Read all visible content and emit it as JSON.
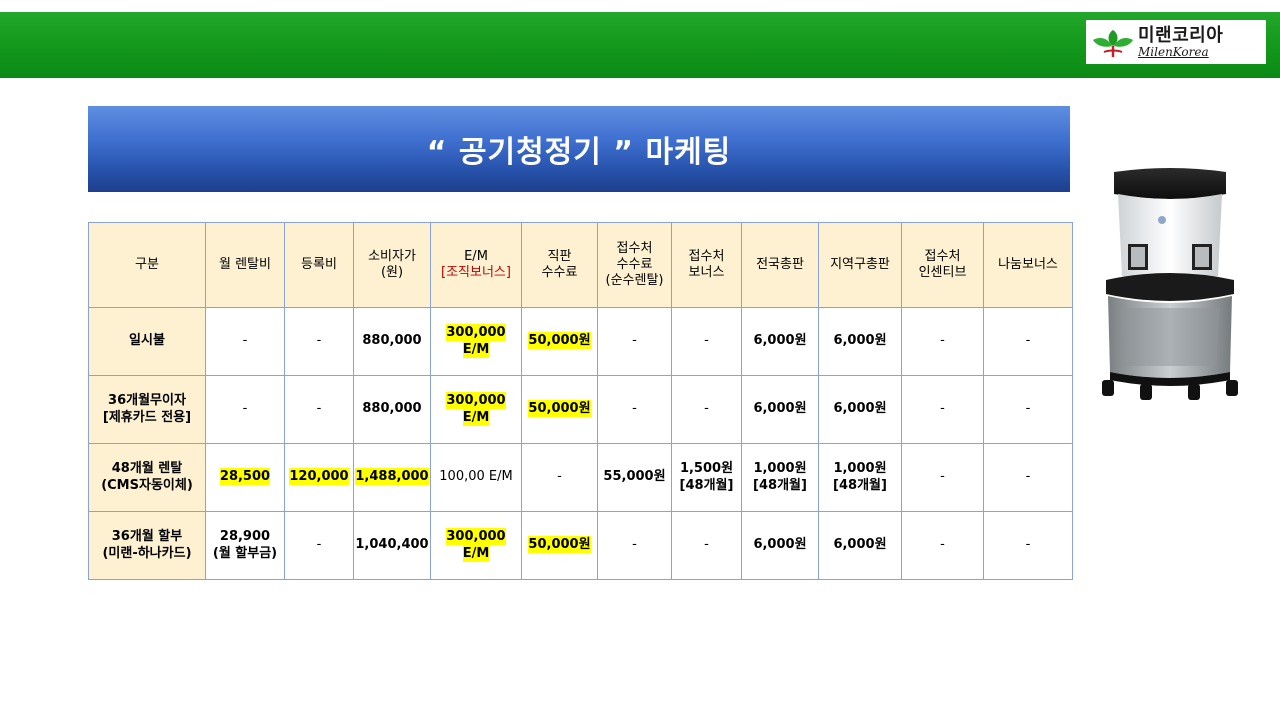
{
  "logo": {
    "korean": "미랜코리아",
    "english": "MilenKorea"
  },
  "title": "“ 공기청정기 ” 마케팅",
  "table": {
    "headers": [
      {
        "lines": [
          "구분"
        ]
      },
      {
        "lines": [
          "월 렌탈비"
        ]
      },
      {
        "lines": [
          "등록비"
        ]
      },
      {
        "lines": [
          "소비자가",
          "(원)"
        ]
      },
      {
        "lines": [
          "E/M",
          "[조직보너스]"
        ]
      },
      {
        "lines": [
          "직판",
          "수수료"
        ]
      },
      {
        "lines": [
          "접수처",
          "수수료",
          "(순수렌탈)"
        ]
      },
      {
        "lines": [
          "접수처",
          "보너스"
        ]
      },
      {
        "lines": [
          "전국총판"
        ]
      },
      {
        "lines": [
          "지역구총판"
        ]
      },
      {
        "lines": [
          "접수처",
          "인센티브"
        ]
      },
      {
        "lines": [
          "나눔보너스"
        ]
      }
    ],
    "rows": [
      [
        {
          "lines": [
            "일시불"
          ]
        },
        {
          "lines": [
            "-"
          ]
        },
        {
          "lines": [
            "-"
          ]
        },
        {
          "lines": [
            "880,000"
          ]
        },
        {
          "lines": [
            "300,000 E/M"
          ],
          "highlight": true
        },
        {
          "lines": [
            "50,000원"
          ],
          "highlight": true
        },
        {
          "lines": [
            "-"
          ]
        },
        {
          "lines": [
            "-"
          ]
        },
        {
          "lines": [
            "6,000원"
          ]
        },
        {
          "lines": [
            "6,000원"
          ]
        },
        {
          "lines": [
            "-"
          ]
        },
        {
          "lines": [
            "-"
          ]
        }
      ],
      [
        {
          "lines": [
            "36개월무이자",
            "[제휴카드 전용]"
          ]
        },
        {
          "lines": [
            "-"
          ]
        },
        {
          "lines": [
            "-"
          ]
        },
        {
          "lines": [
            "880,000"
          ]
        },
        {
          "lines": [
            "300,000 E/M"
          ],
          "highlight": true
        },
        {
          "lines": [
            "50,000원"
          ],
          "highlight": true
        },
        {
          "lines": [
            "-"
          ]
        },
        {
          "lines": [
            "-"
          ]
        },
        {
          "lines": [
            "6,000원"
          ]
        },
        {
          "lines": [
            "6,000원"
          ]
        },
        {
          "lines": [
            "-"
          ]
        },
        {
          "lines": [
            "-"
          ]
        }
      ],
      [
        {
          "lines": [
            "48개월 렌탈",
            "(CMS자동이체)"
          ]
        },
        {
          "lines": [
            "28,500"
          ],
          "highlight": true
        },
        {
          "lines": [
            "120,000"
          ],
          "highlight": true
        },
        {
          "lines": [
            "1,488,000"
          ],
          "highlight": true
        },
        {
          "lines": [
            "100,00 E/M"
          ]
        },
        {
          "lines": [
            "-"
          ]
        },
        {
          "lines": [
            "55,000원"
          ]
        },
        {
          "lines": [
            "1,500원",
            "[48개월]"
          ]
        },
        {
          "lines": [
            "1,000원",
            "[48개월]"
          ]
        },
        {
          "lines": [
            "1,000원",
            "[48개월]"
          ]
        },
        {
          "lines": [
            "-"
          ]
        },
        {
          "lines": [
            "-"
          ]
        }
      ],
      [
        {
          "lines": [
            "36개월 할부",
            "(미랜-하나카드)"
          ]
        },
        {
          "lines": [
            "28,900",
            "(월 할부금)"
          ]
        },
        {
          "lines": [
            "-"
          ]
        },
        {
          "lines": [
            "1,040,400"
          ]
        },
        {
          "lines": [
            "300,000 E/M"
          ],
          "highlight": true
        },
        {
          "lines": [
            "50,000원"
          ],
          "highlight": true
        },
        {
          "lines": [
            "-"
          ]
        },
        {
          "lines": [
            "-"
          ]
        },
        {
          "lines": [
            "6,000원"
          ]
        },
        {
          "lines": [
            "6,000원"
          ]
        },
        {
          "lines": [
            "-"
          ]
        },
        {
          "lines": [
            "-"
          ]
        }
      ]
    ]
  },
  "colors": {
    "header_bar": "#169a1e",
    "title_banner": "#2f5fbf",
    "header_cell_bg": "#fdf1d2",
    "highlight": "#ffff00",
    "em_bonus_red": "#c00000"
  }
}
